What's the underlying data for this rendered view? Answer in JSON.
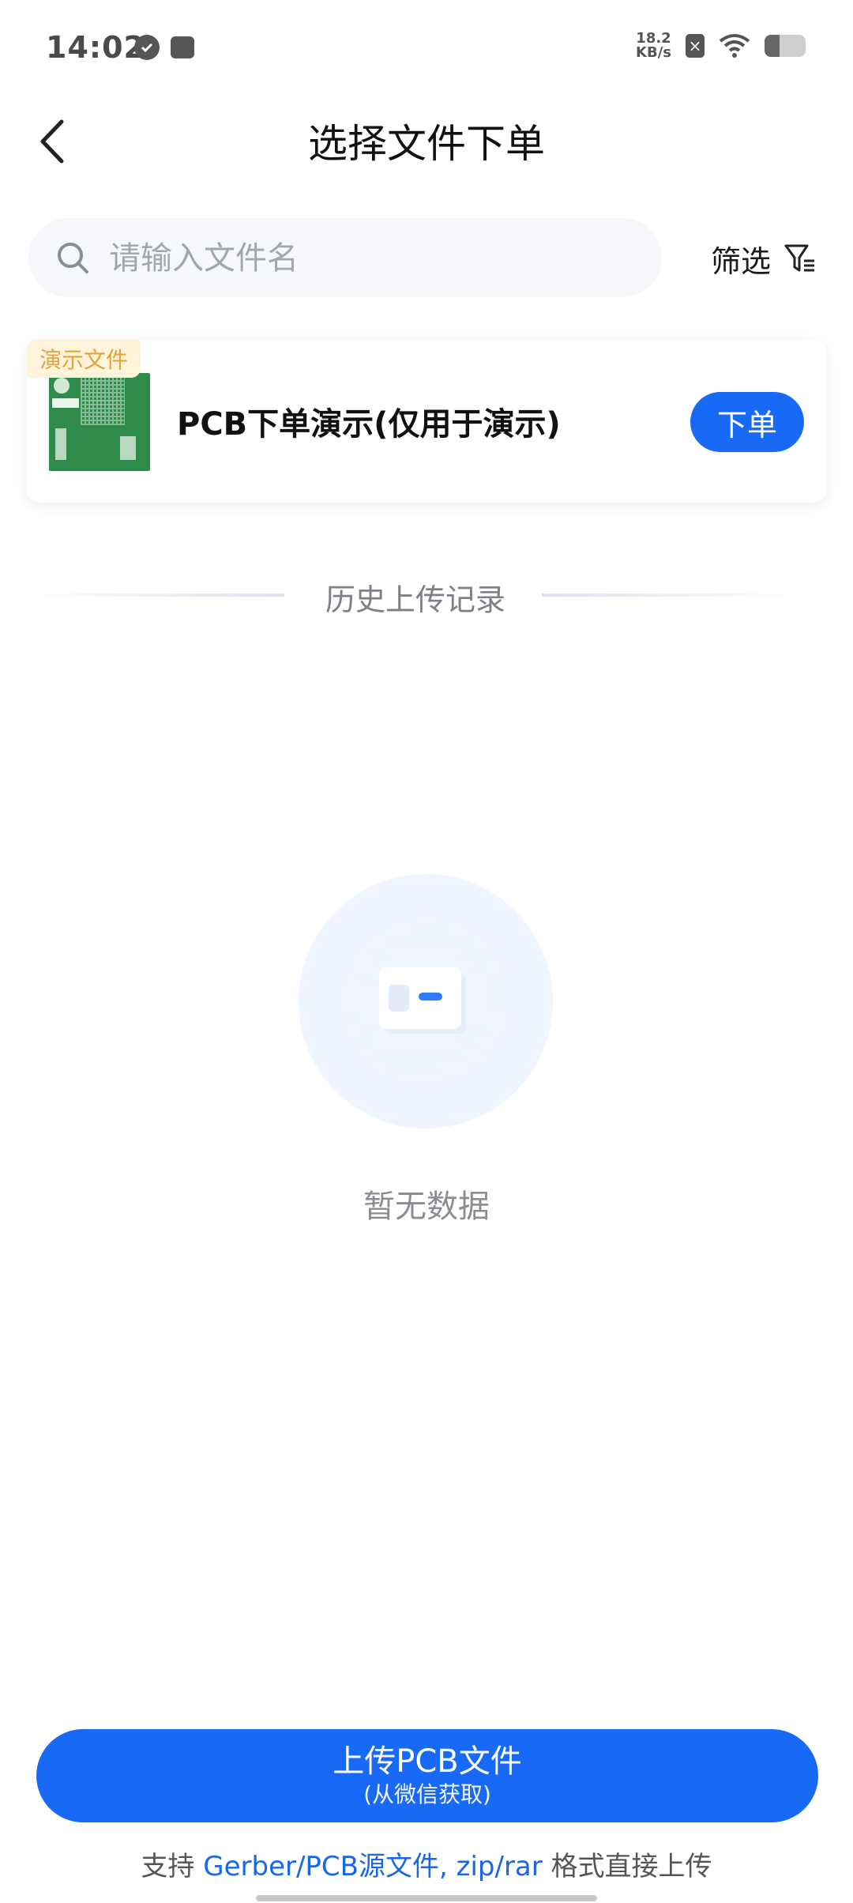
{
  "status_bar": {
    "time": "14:02",
    "net_speed_value": "18.2",
    "net_speed_unit": "KB/s",
    "battery_level": 0.36
  },
  "header": {
    "title": "选择文件下单"
  },
  "search": {
    "placeholder": "请输入文件名",
    "value": ""
  },
  "filter": {
    "label": "筛选"
  },
  "demo_card": {
    "badge": "演示文件",
    "title": "PCB下单演示(仅用于演示)",
    "order_label": "下单"
  },
  "history": {
    "label": "历史上传记录"
  },
  "empty_state": {
    "text": "暂无数据"
  },
  "upload": {
    "label": "上传PCB文件",
    "sublabel": "(从微信获取)"
  },
  "support": {
    "prefix": "支持 ",
    "formats": "Gerber/PCB源文件, zip/rar",
    "suffix": " 格式直接上传"
  },
  "colors": {
    "accent": "#1869f5",
    "badge_bg": "#fff3d9",
    "badge_text": "#e2a33b",
    "link": "#1a66e8"
  }
}
